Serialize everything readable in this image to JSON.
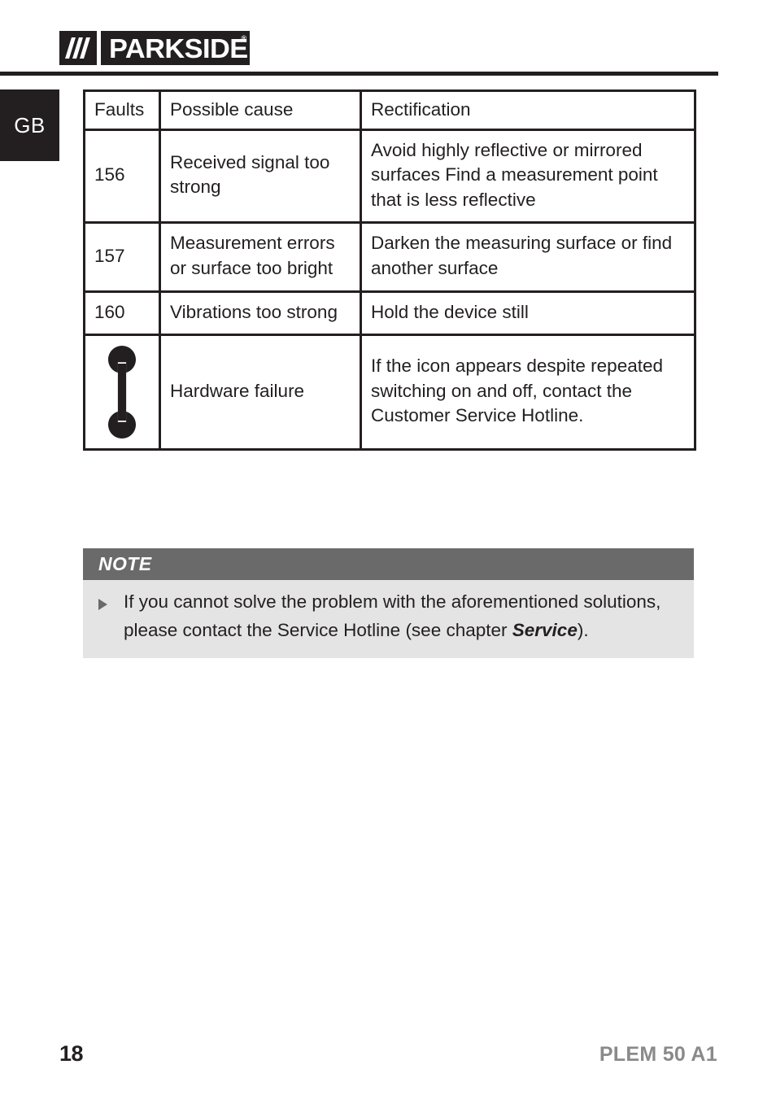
{
  "header": {
    "brand": "PARKSIDE",
    "brand_mark": "®",
    "logo_icon": "three-slashes-icon"
  },
  "language_tab": {
    "label": "GB"
  },
  "fault_table": {
    "columns": [
      "Faults",
      "Possible cause",
      "Rectification"
    ],
    "rows": [
      {
        "fault": "156",
        "fault_icon": null,
        "cause": "Received signal too strong",
        "rectification": "Avoid highly reflective or mirrored surfaces\nFind a measurement point that is less reflective"
      },
      {
        "fault": "157",
        "fault_icon": null,
        "cause": "Measurement errors or surface too bright",
        "rectification": "Darken the measuring surface or find another surface"
      },
      {
        "fault": "160",
        "fault_icon": null,
        "cause": "Vibrations too strong",
        "rectification": "Hold the device still"
      },
      {
        "fault": "",
        "fault_icon": "wrench-icon",
        "cause": "Hardware failure",
        "rectification": "If the icon appears despite repeated switching on and off, contact the Customer Service Hotline."
      }
    ]
  },
  "note": {
    "title": "NOTE",
    "bullet_icon": "triangle-bullet-icon",
    "text_before_emphasis": "If you cannot solve the problem with the aforementioned solutions, please contact the Service Hotline (see chapter ",
    "emphasis": "Service",
    "text_after_emphasis": ")."
  },
  "footer": {
    "page_number": "18",
    "model": "PLEM 50 A1"
  },
  "colors": {
    "ink": "#231f20",
    "note_header_bg": "#6a6a6a",
    "note_body_bg": "#e4e4e4",
    "footer_model": "#8a8a8a"
  }
}
